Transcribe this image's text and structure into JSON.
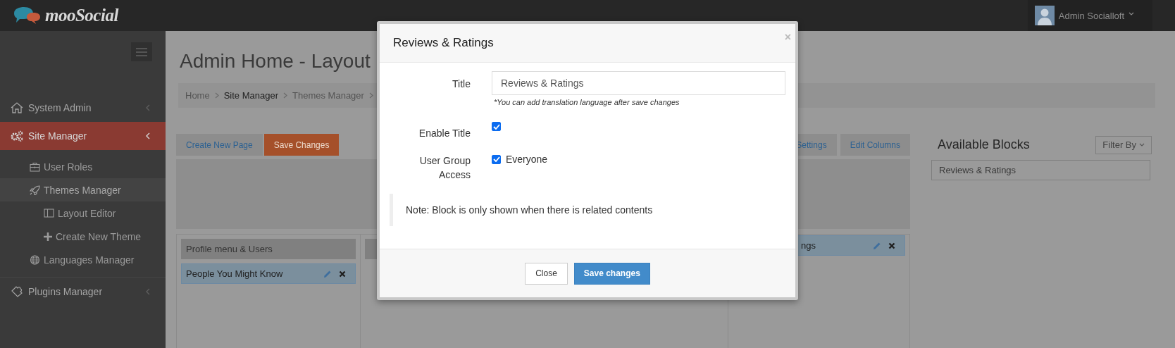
{
  "brand": {
    "name": "mooSocial"
  },
  "user_menu": {
    "name": "Admin Socialloft"
  },
  "sidebar": {
    "items": [
      {
        "label": "System Admin",
        "selected": false
      },
      {
        "label": "Site Manager",
        "selected": true,
        "children": [
          {
            "label": "User Roles",
            "selected": false
          },
          {
            "label": "Themes Manager",
            "selected": true,
            "children": [
              {
                "label": "Layout Editor",
                "selected": false
              },
              {
                "label": "Create New Theme",
                "selected": false
              }
            ]
          },
          {
            "label": "Languages Manager",
            "selected": false
          }
        ]
      },
      {
        "label": "Plugins Manager",
        "selected": false
      }
    ]
  },
  "page": {
    "title": "Admin Home - Layout",
    "breadcrumb": [
      {
        "label": "Home",
        "active": false
      },
      {
        "label": "Site Manager",
        "active": true
      },
      {
        "label": "Themes Manager",
        "active": false
      }
    ],
    "toolbar": [
      {
        "label": "Create New Page",
        "kind": "default"
      },
      {
        "label": "Save Changes",
        "kind": "primary"
      }
    ],
    "toolbar_right": [
      {
        "label": "Settings"
      },
      {
        "label": "Edit Columns"
      }
    ],
    "column_1": {
      "header": "Profile menu & Users",
      "blocks": [
        {
          "label": "People You Might Know"
        }
      ]
    },
    "column_3": {
      "blocks": [
        {
          "label": "ngs"
        }
      ]
    }
  },
  "available_blocks": {
    "title": "Available Blocks",
    "filter": "Filter By",
    "items": [
      {
        "label": "Reviews & Ratings"
      }
    ]
  },
  "modal": {
    "title": "Reviews & Ratings",
    "close_symbol": "×",
    "fields": [
      {
        "kind": "text",
        "label": "Title",
        "value": "Reviews & Ratings",
        "hint": "*You can add translation language after save changes"
      },
      {
        "kind": "checkbox",
        "label": "Enable Title",
        "checked": true
      },
      {
        "kind": "checkbox",
        "label": "User Group Access",
        "checked": true,
        "option": "Everyone"
      }
    ],
    "note": "Note: Block is only shown when there is related contents",
    "buttons": [
      {
        "label": "Close",
        "kind": "default"
      },
      {
        "label": "Save changes",
        "kind": "primary"
      }
    ]
  }
}
